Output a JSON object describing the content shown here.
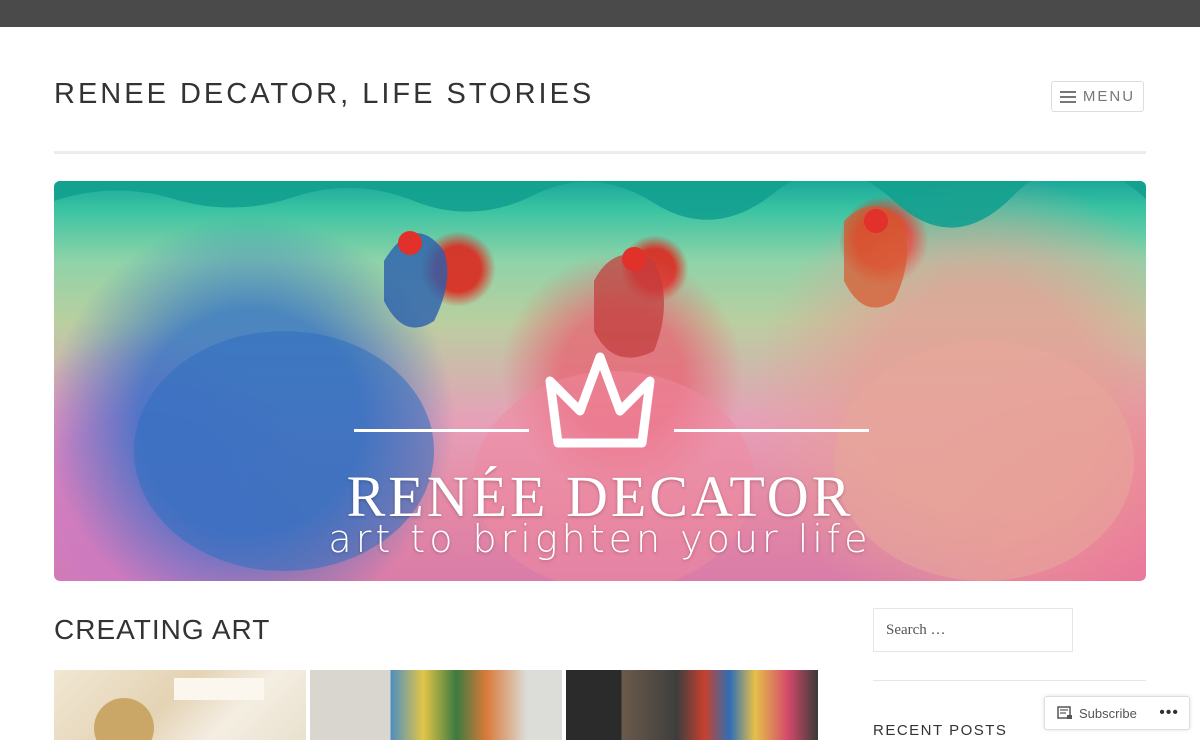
{
  "header": {
    "site_title": "RENEE DECATOR, LIFE STORIES",
    "menu_label": "MENU"
  },
  "banner": {
    "title": "RENÉE DECATOR",
    "tagline": "art to brighten your life"
  },
  "main": {
    "section_title": "CREATING ART"
  },
  "sidebar": {
    "search_placeholder": "Search …",
    "recent_posts_title": "RECENT POSTS"
  },
  "subscribe_bar": {
    "subscribe_label": "Subscribe",
    "more_label": "•••"
  },
  "colors": {
    "topbar": "#4a4a4a",
    "text": "#333333",
    "divider": "#ececec"
  }
}
